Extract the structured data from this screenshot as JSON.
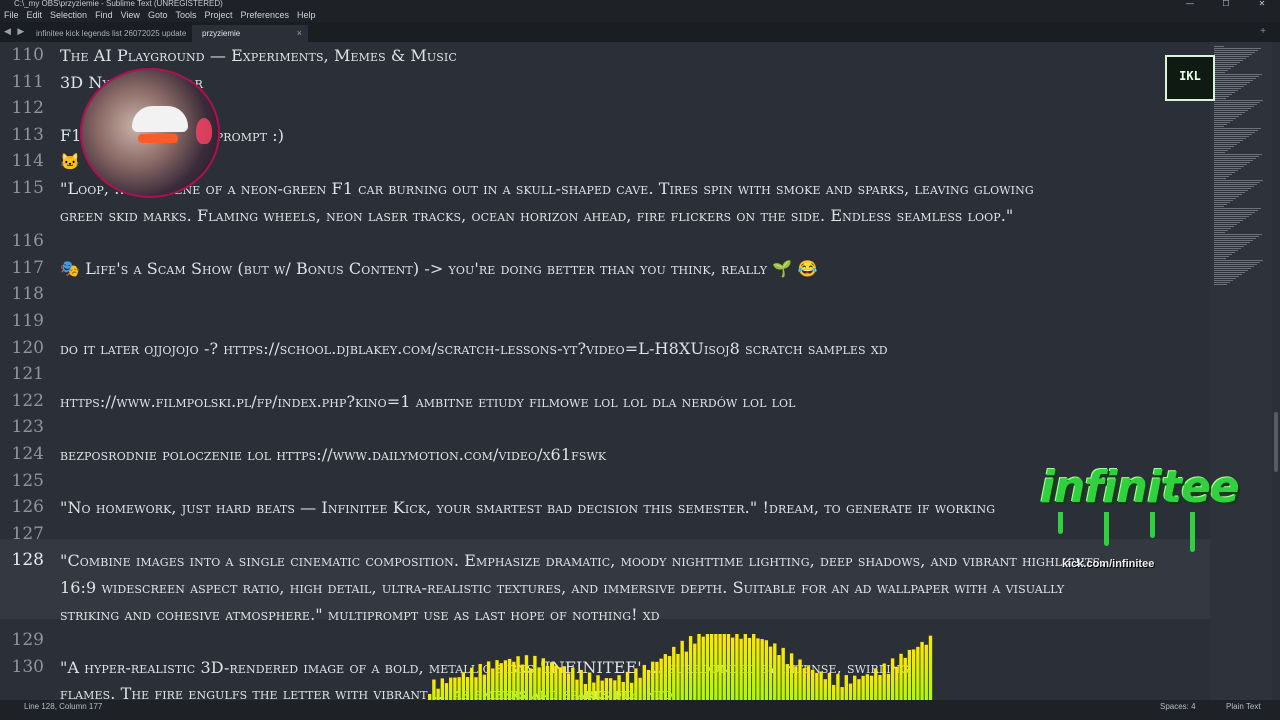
{
  "window": {
    "title": "C:\\_my OBS\\przyziemie - Sublime Text (UNREGISTERED)",
    "controls": [
      "—",
      "☐",
      "✕"
    ]
  },
  "menu": [
    "File",
    "Edit",
    "Selection",
    "Find",
    "View",
    "Goto",
    "Tools",
    "Project",
    "Preferences",
    "Help"
  ],
  "tabs": [
    {
      "label": "infinitee kick legends list 26072025 update",
      "active": false
    },
    {
      "label": "przyziemie",
      "active": true,
      "close": "×"
    }
  ],
  "tab_nav": "◀ ▶",
  "tab_add": "+",
  "lines": [
    {
      "num": "110",
      "text": "The AI Playground — Experiments, Memes & Music"
    },
    {
      "num": "111",
      "text": "3D Nylon Bar Bar"
    },
    {
      "num": "112",
      "text": ""
    },
    {
      "num": "113",
      "text": "F1 ... Cave AI video prompt :)"
    },
    {
      "num": "114",
      "text": "🐱"
    },
    {
      "num": "115",
      "text": "\"Loop, ... nk scene of a neon-green F1 car burning out in a skull-shaped cave. Tires spin with smoke and sparks, leaving glowing"
    },
    {
      "num": "",
      "text": "green skid marks. Flaming wheels, neon laser tracks, ocean horizon ahead, fire flickers on the side. Endless seamless loop.\""
    },
    {
      "num": "116",
      "text": ""
    },
    {
      "num": "117",
      "text": "🎭 Life's a Scam Show (but w/ Bonus Content) -> you're doing better than you think, really 🌱 😂"
    },
    {
      "num": "118",
      "text": ""
    },
    {
      "num": "119",
      "text": ""
    },
    {
      "num": "120",
      "text": "do it later ojjojojo -? https://school.djblakey.com/scratch-lessons-yt?video=L-H8XUisoj8 scratch samples xd"
    },
    {
      "num": "121",
      "text": ""
    },
    {
      "num": "122",
      "text": "https://www.filmpolski.pl/fp/index.php?kino=1 ambitne etiudy filmowe lol lol dla nerdów lol lol"
    },
    {
      "num": "123",
      "text": ""
    },
    {
      "num": "124",
      "text": "bezposrodnie poloczenie lol https://www.dailymotion.com/video/x61fswk"
    },
    {
      "num": "125",
      "text": ""
    },
    {
      "num": "126",
      "text": "\"No homework, just hard beats — Infinitee Kick, your smartest bad decision this semester.\" !dream, to generate if working"
    },
    {
      "num": "127",
      "text": ""
    },
    {
      "num": "128",
      "text": "\"Combine images into a single cinematic composition. Emphasize dramatic, moody nighttime lighting, deep shadows, and vibrant highlights."
    },
    {
      "num": "",
      "text": "16:9 widescreen aspect ratio, high detail, ultra-realistic textures, and immersive depth. Suitable for an ad wallpaper with a visually"
    },
    {
      "num": "",
      "text": "striking and cohesive atmosphere.\" multiprompt use as last hope of nothing! xd"
    },
    {
      "num": "129",
      "text": ""
    },
    {
      "num": "130",
      "text": "\"A hyper-realistic 3D-rendered image of a bold, metallic signs 'INFINITEE' ... surrounded by intense, swirling"
    },
    {
      "num": "",
      "text": "flames. The fire engulfs the letter with vibrant ... as embers and sparks fly into"
    }
  ],
  "current_line": "128",
  "status": {
    "position": "Line 128, Column 177",
    "spaces": "Spaces: 4",
    "syntax": "Plain Text"
  },
  "overlay": {
    "logo_text": "infinitee",
    "logo_sub": "kick.com/infinitee",
    "badge_text": "IKL"
  },
  "colors": {
    "accent_green": "#2fd13f",
    "visualizer_top": "#ffe800",
    "visualizer_bottom": "#9cff00",
    "editor_bg": "#2b3038"
  }
}
